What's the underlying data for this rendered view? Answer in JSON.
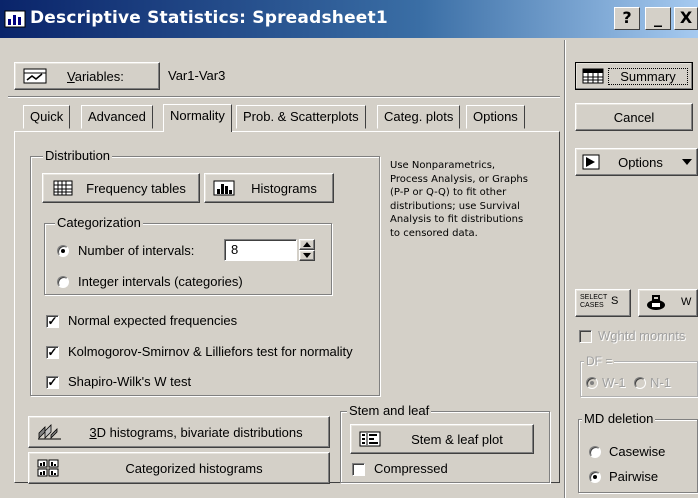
{
  "window": {
    "title": "Descriptive Statistics: Spreadsheet1",
    "help_glyph": "?",
    "minimize_glyph": "_",
    "close_glyph": "X"
  },
  "variables": {
    "button_label": "Variables:",
    "value": "Var1-Var3"
  },
  "tabs": [
    {
      "label": "Quick"
    },
    {
      "label": "Advanced"
    },
    {
      "label": "Normality"
    },
    {
      "label": "Prob. & Scatterplots"
    },
    {
      "label": "Categ. plots"
    },
    {
      "label": "Options"
    }
  ],
  "active_tab": "Normality",
  "distribution": {
    "group_label": "Distribution",
    "frequency_tables_label": "Frequency tables",
    "histograms_label": "Histograms",
    "categorization": {
      "group_label": "Categorization",
      "number_of_intervals_label": "Number of intervals:",
      "number_of_intervals_value": "8",
      "integer_intervals_label": "Integer intervals (categories)",
      "selected": "number_of_intervals"
    }
  },
  "checks": {
    "normal_expected_label": "Normal expected frequencies",
    "normal_expected": true,
    "ks_label": "Kolmogorov-Smirnov & Lilliefors test for normality",
    "ks": true,
    "shapiro_label": "Shapiro-Wilk's W test",
    "shapiro": true
  },
  "note": [
    "Use Nonparametrics,",
    "Process Analysis, or Graphs",
    "(P-P or Q-Q) to fit other",
    "distributions; use Survival",
    "Analysis to fit distributions",
    "to censored data."
  ],
  "bottom": {
    "histograms_3d_label": "3D histograms, bivariate distributions",
    "categorized_histograms_label": "Categorized histograms",
    "stem_leaf": {
      "group_label": "Stem and leaf",
      "plot_label": "Stem & leaf plot",
      "compressed_label": "Compressed",
      "compressed": false
    }
  },
  "sidebar": {
    "summary_label": "Summary",
    "cancel_label": "Cancel",
    "options_label": "Options",
    "select_cases_label": "SELECT CASES",
    "select_cases_letter": "S",
    "w_letter": "W",
    "wghtd_momnts_label": "Wghtd momnts",
    "df_label": "DF =",
    "df_w1_label": "W-1",
    "df_n1_label": "N-1",
    "md_deletion": {
      "group_label": "MD deletion",
      "casewise_label": "Casewise",
      "pairwise_label": "Pairwise",
      "selected": "pairwise"
    }
  }
}
